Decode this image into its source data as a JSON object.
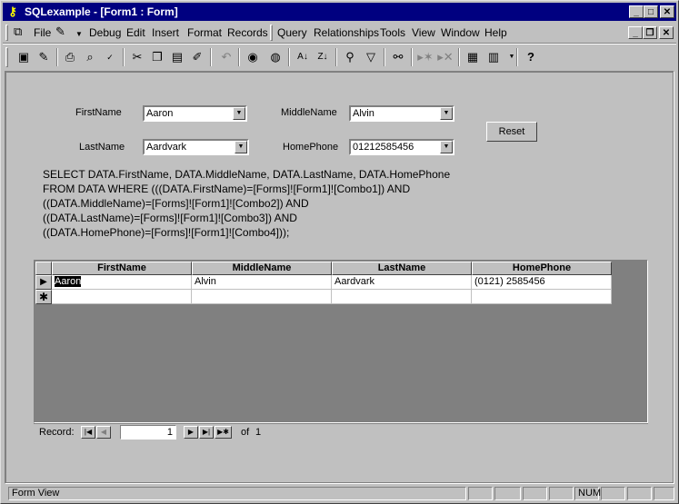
{
  "window": {
    "title": "SQLexample - [Form1 : Form]",
    "app_icon": "key-icon"
  },
  "menu": [
    "File",
    "Debug",
    "Edit",
    "Insert",
    "Format",
    "Records",
    "Query",
    "Relationships",
    "Tools",
    "View",
    "Window",
    "Help"
  ],
  "form": {
    "firstname_label": "FirstName",
    "firstname_value": "Aaron",
    "middlename_label": "MiddleName",
    "middlename_value": "Alvin",
    "lastname_label": "LastName",
    "lastname_value": "Aardvark",
    "homephone_label": "HomePhone",
    "homephone_value": "01212585456",
    "reset_label": "Reset"
  },
  "sql_text": "SELECT DATA.FirstName, DATA.MiddleName, DATA.LastName, DATA.HomePhone\nFROM DATA WHERE (((DATA.FirstName)=[Forms]![Form1]![Combo1]) AND\n((DATA.MiddleName)=[Forms]![Form1]![Combo2]) AND\n((DATA.LastName)=[Forms]![Form1]![Combo3]) AND\n((DATA.HomePhone)=[Forms]![Form1]![Combo4]));",
  "grid": {
    "columns": [
      "FirstName",
      "MiddleName",
      "LastName",
      "HomePhone"
    ],
    "rows": [
      [
        "Aaron",
        "Alvin",
        "Aardvark",
        "(0121) 2585456"
      ]
    ]
  },
  "nav": {
    "record_label": "Record:",
    "current": "1",
    "of_label": "of",
    "total": "1"
  },
  "status": {
    "left": "Form View",
    "num": "NUM"
  }
}
